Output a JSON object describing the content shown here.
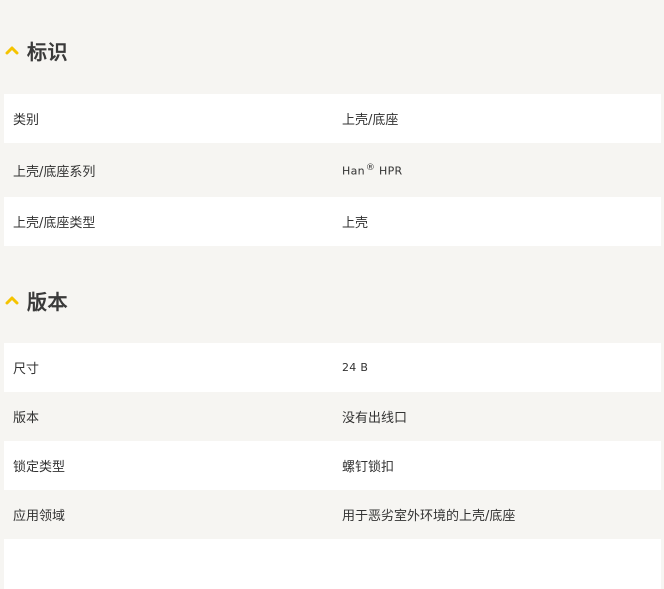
{
  "colors": {
    "accent": "#f5c400",
    "background": "#f6f5f2",
    "row_white": "#ffffff",
    "text": "#333333"
  },
  "sections": [
    {
      "title": "标识",
      "icon": "chevron-up-icon",
      "rows": [
        {
          "label": "类别",
          "value": "上壳/底座"
        },
        {
          "label": "上壳/底座系列",
          "value": "Han",
          "value_mark": "®",
          "value_suffix": " HPR"
        },
        {
          "label": "上壳/底座类型",
          "value": "上壳"
        }
      ]
    },
    {
      "title": "版本",
      "icon": "chevron-up-icon",
      "rows": [
        {
          "label": "尺寸",
          "value": "24 B"
        },
        {
          "label": "版本",
          "value": "没有出线口"
        },
        {
          "label": "锁定类型",
          "value": "螺钉锁扣"
        },
        {
          "label": "应用领域",
          "value": "用于恶劣室外环境的上壳/底座"
        }
      ]
    }
  ]
}
